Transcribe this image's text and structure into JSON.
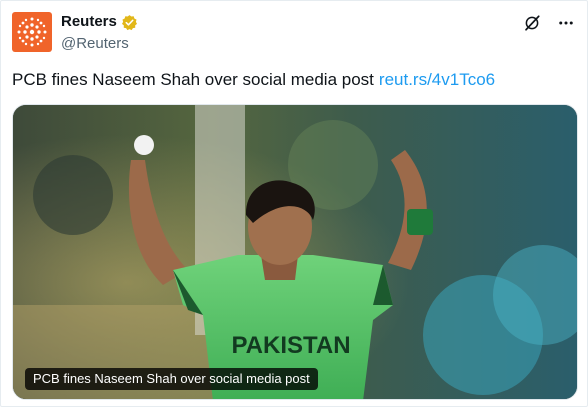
{
  "account": {
    "display_name": "Reuters",
    "handle": "@Reuters",
    "verified": true,
    "brand_color": "#f0642a",
    "verified_color": "#e2b719"
  },
  "actions": {
    "grok_icon": "grok-icon",
    "more_icon": "more-horizontal-icon"
  },
  "tweet": {
    "text": "PCB fines Naseem Shah over social media post",
    "link_text": "reut.rs/4v1Tco6",
    "link_color": "#1d9bf0"
  },
  "media": {
    "jersey_text": "PAKISTAN",
    "caption": "PCB fines Naseem Shah over social media post"
  }
}
